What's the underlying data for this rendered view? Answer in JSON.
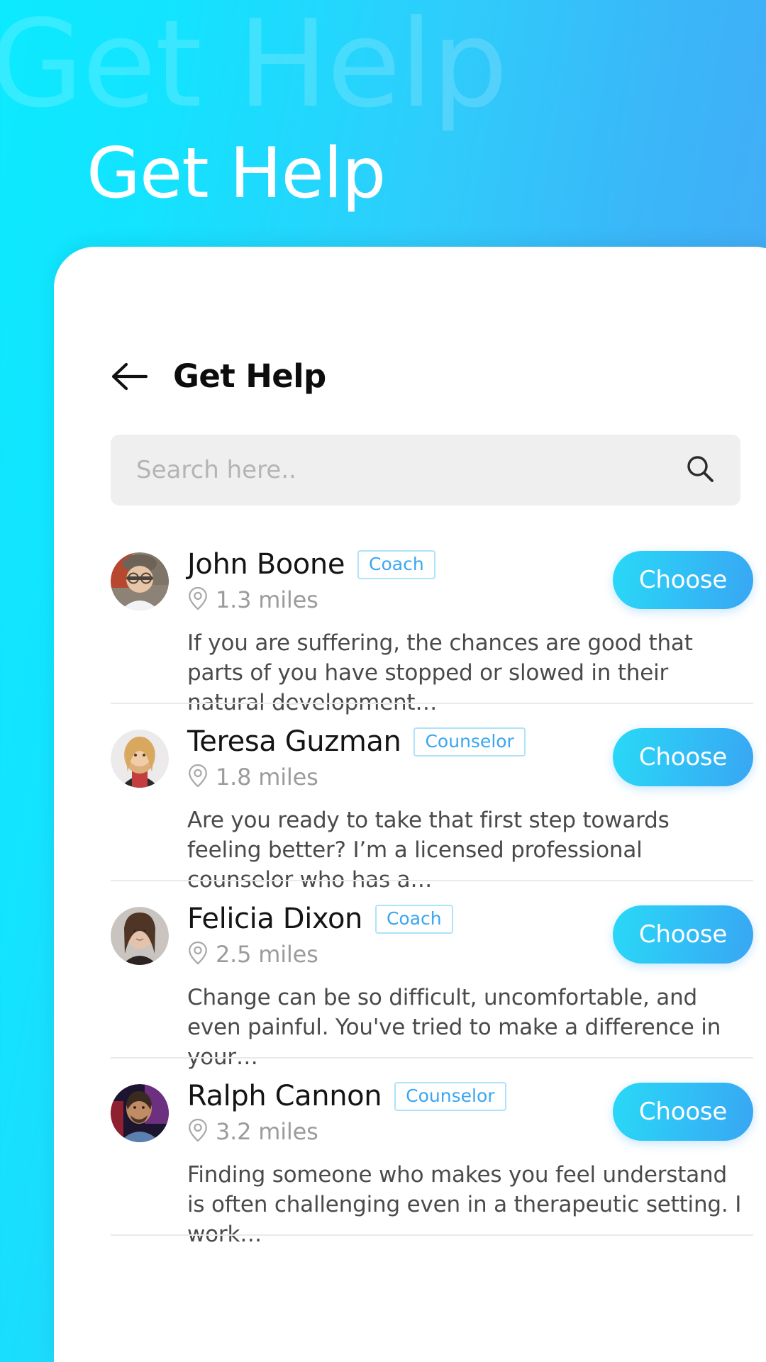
{
  "hero": {
    "ghost_title": "Get Help",
    "title": "Get Help"
  },
  "screen": {
    "title": "Get Help",
    "back_icon": "arrow-left-icon"
  },
  "search": {
    "placeholder": "Search here..",
    "value": "",
    "icon": "search-icon"
  },
  "theme": {
    "gradient_start": "#0ceaff",
    "gradient_end": "#4aa3f5",
    "button_gradient_start": "#29d9f7",
    "button_gradient_end": "#39a6f4",
    "badge_text_color": "#3aa6f0",
    "badge_border_color": "#aee3f9",
    "sheet_background": "#ffffff",
    "search_background": "#efefef",
    "divider_color": "#e9e9e9"
  },
  "list": {
    "choose_label": "Choose",
    "distance_icon": "map-pin-icon",
    "providers": [
      {
        "name": "John Boone",
        "role": "Coach",
        "distance": "1.3 miles",
        "bio": "If you are suffering, the chances are good that parts of you have stopped or slowed in their natural development…",
        "avatar": "avatar-john-boone",
        "avatar_colors": [
          "#8c8276",
          "#b8472f",
          "#e8d9c8",
          "#5f5a52"
        ]
      },
      {
        "name": "Teresa Guzman",
        "role": "Counselor",
        "distance": "1.8 miles",
        "bio": "Are you ready to take that first step towards feeling better? I’m a licensed professional counselor who has a…",
        "avatar": "avatar-teresa-guzman",
        "avatar_colors": [
          "#e8e2dc",
          "#d9a86a",
          "#c33f3f",
          "#2b2b2b"
        ]
      },
      {
        "name": "Felicia Dixon",
        "role": "Coach",
        "distance": "2.5 miles",
        "bio": "Change can be so difficult, uncomfortable, and even painful. You've tried to make a difference in your…",
        "avatar": "avatar-felicia-dixon",
        "avatar_colors": [
          "#c9c4bf",
          "#6b4a37",
          "#e4c3ac",
          "#2c2420"
        ]
      },
      {
        "name": "Ralph Cannon",
        "role": "Counselor",
        "distance": "3.2 miles",
        "bio": "Finding someone who makes you feel understand is often challenging even in a therapeutic setting. I work…",
        "avatar": "avatar-ralph-cannon",
        "avatar_colors": [
          "#1d1430",
          "#7b3a8c",
          "#b8886a",
          "#5b7fae"
        ]
      }
    ]
  }
}
